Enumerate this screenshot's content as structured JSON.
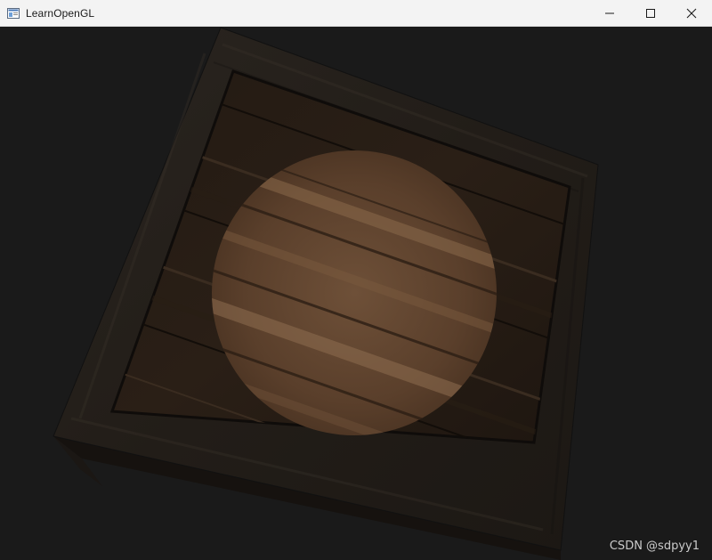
{
  "window": {
    "title": "LearnOpenGL",
    "icon": "app-window-icon",
    "controls": {
      "minimize_icon": "minimize-icon",
      "maximize_icon": "maximize-icon",
      "close_icon": "close-icon"
    }
  },
  "scene": {
    "background_color": "#1a1a1a",
    "object": "textured wooden crate",
    "overlay": "circular highlight"
  },
  "watermark": {
    "text": "CSDN @sdpyy1"
  }
}
